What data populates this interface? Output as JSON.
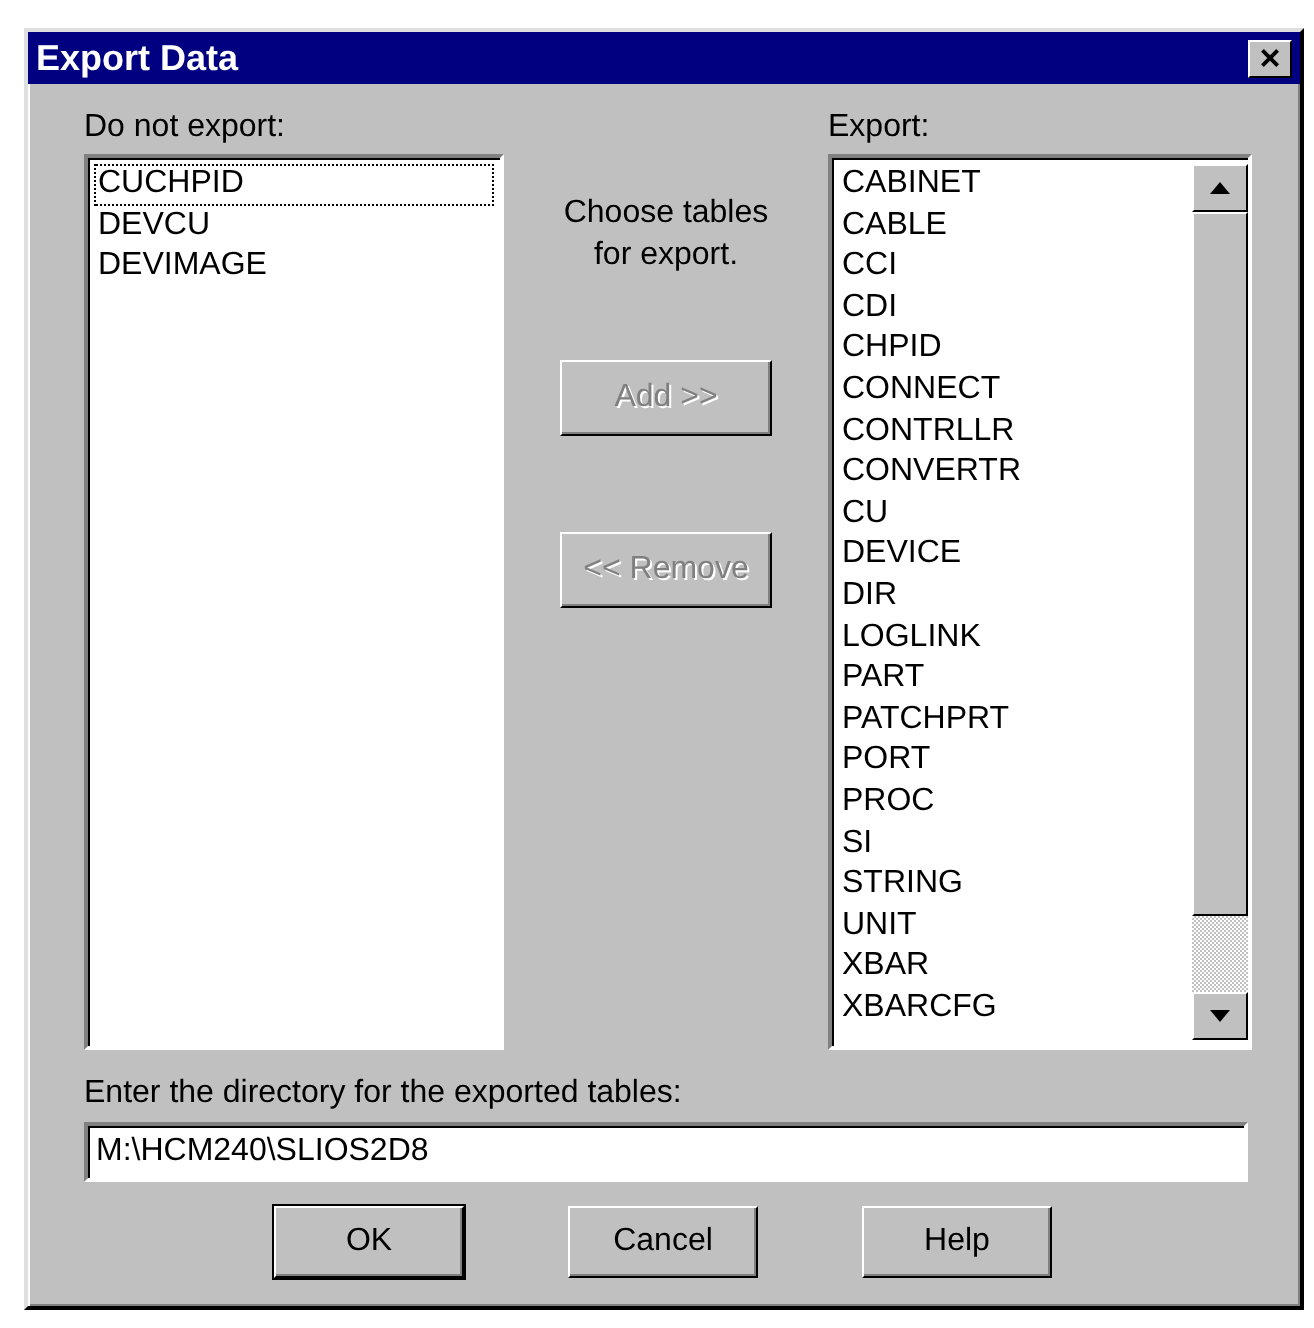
{
  "window": {
    "title": "Export Data",
    "close": "×"
  },
  "not_export": {
    "label": "Do not export:",
    "items": [
      {
        "text": "CUCHPID",
        "focused": true
      },
      {
        "text": "DEVCU",
        "focused": false
      },
      {
        "text": "DEVIMAGE",
        "focused": false
      }
    ]
  },
  "hint": "Choose tables for export.",
  "buttons_middle": [
    {
      "label": "Add >>",
      "disabled": true
    },
    {
      "label": "<< Remove",
      "disabled": true
    }
  ],
  "export": {
    "label": "Export:",
    "items": [
      {
        "text": "CABINET"
      },
      {
        "text": "CABLE"
      },
      {
        "text": "CCI"
      },
      {
        "text": "CDI"
      },
      {
        "text": "CHPID"
      },
      {
        "text": "CONNECT"
      },
      {
        "text": "CONTRLLR"
      },
      {
        "text": "CONVERTR"
      },
      {
        "text": "CU"
      },
      {
        "text": "DEVICE"
      },
      {
        "text": "DIR"
      },
      {
        "text": "LOGLINK"
      },
      {
        "text": "PART"
      },
      {
        "text": "PATCHPRT"
      },
      {
        "text": "PORT"
      },
      {
        "text": "PROC"
      },
      {
        "text": "SI"
      },
      {
        "text": "STRING"
      },
      {
        "text": "UNIT"
      },
      {
        "text": "XBAR"
      },
      {
        "text": "XBARCFG"
      }
    ]
  },
  "directory": {
    "label": "Enter the directory for the exported tables:",
    "value": "M:\\HCM240\\SLIOS2D8"
  },
  "buttons": [
    {
      "label": "OK",
      "default": true
    },
    {
      "label": "Cancel",
      "default": false
    },
    {
      "label": "Help",
      "default": false
    }
  ]
}
